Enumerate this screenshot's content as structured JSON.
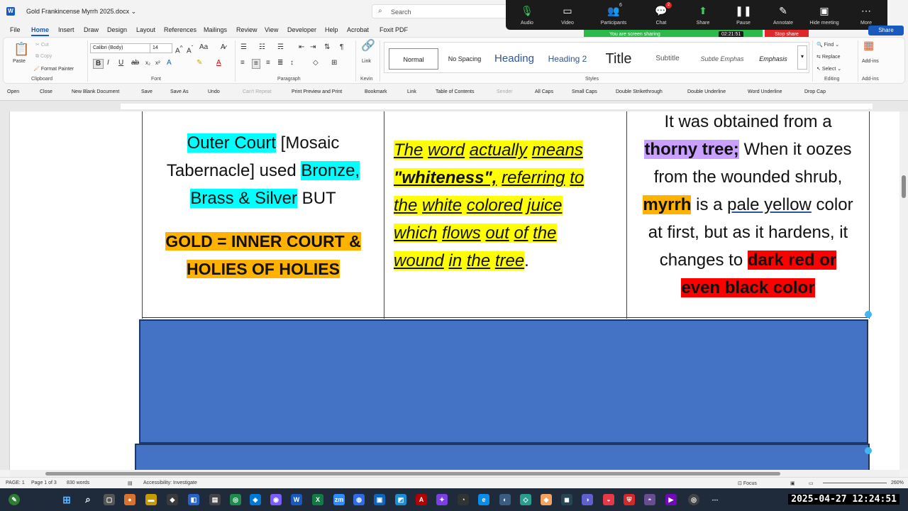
{
  "titlebar": {
    "app_icon": "W",
    "doc_title": "Gold Frankincense Myrrh 2025.docx ⌄",
    "search_placeholder": "Search"
  },
  "zoom": {
    "buttons": [
      {
        "label": "Audio",
        "icon": "mic-icon",
        "glyph": "🎙"
      },
      {
        "label": "Video",
        "icon": "camera-icon",
        "glyph": "▭"
      },
      {
        "label": "Participants",
        "icon": "participants-icon",
        "glyph": "👥",
        "count": "6"
      },
      {
        "label": "Chat",
        "icon": "chat-icon",
        "glyph": "💬",
        "badge": "2"
      },
      {
        "label": "Share",
        "icon": "share-screen-icon",
        "glyph": "⬆"
      },
      {
        "label": "Pause",
        "icon": "pause-icon",
        "glyph": "❚❚"
      },
      {
        "label": "Annotate",
        "icon": "pen-icon",
        "glyph": "✎"
      },
      {
        "label": "Hide meeting",
        "icon": "hide-meeting-icon",
        "glyph": "▣"
      },
      {
        "label": "More",
        "icon": "more-icon",
        "glyph": "⋯"
      }
    ],
    "sharing_text": "You are screen sharing",
    "timer": "02:21:51",
    "stop_share": "Stop share"
  },
  "ribbon_tabs": [
    "File",
    "Home",
    "Insert",
    "Draw",
    "Design",
    "Layout",
    "References",
    "Mailings",
    "Review",
    "View",
    "Developer",
    "Help",
    "Acrobat",
    "Foxit PDF"
  ],
  "share_button": "Share",
  "ribbon": {
    "clipboard": {
      "paste": "Paste",
      "cut": "Cut",
      "copy": "Copy",
      "format_painter": "Format Painter",
      "label": "Clipboard"
    },
    "font": {
      "name": "Calibri (Body)",
      "size": "14",
      "label": "Font"
    },
    "paragraph": {
      "label": "Paragraph"
    },
    "kevin": {
      "link": "Link",
      "label": "Kevin"
    },
    "styles": {
      "label": "Styles",
      "items": [
        "Normal",
        "No Spacing",
        "Heading",
        "Heading 2",
        "Title",
        "Subtitle",
        "Subtle Emphas",
        "Emphasis"
      ]
    },
    "editing": {
      "find": "Find",
      "replace": "Replace",
      "select": "Select",
      "label": "Editing"
    },
    "addins": {
      "label": "Add-ins",
      "name": "Add-ins"
    }
  },
  "qat": [
    "Open",
    "Close",
    "New Blank Document",
    "Save",
    "Save As",
    "Undo",
    "Can't Repeat",
    "Print Preview and Print",
    "Bookmark",
    "Link",
    "Table of Contents",
    "Sender",
    "All Caps",
    "Small Caps",
    "Double Strikethrough",
    "Double Underline",
    "Word Underline",
    "Drop Cap"
  ],
  "document": {
    "col1": {
      "a1": "Outer Court",
      "a2": " [Mosaic Tabernacle] used ",
      "a3": "Bronze,",
      "a4": "Brass & Silver",
      "a5": " BUT",
      "b1": "GOLD = INNER COURT &",
      "b2": "HOLIES OF HOLIES"
    },
    "col2": {
      "w1": "The",
      "w2": "word",
      "w3": "actually",
      "w4": "means",
      "w5": "\"whiteness\",",
      "w6": "referring",
      "w7": "to",
      "w8": "the",
      "w9": "white",
      "w10": "colored",
      "w11": "juice",
      "w12": "which",
      "w13": "flows",
      "w14": "out",
      "w15": "of",
      "w16": "the",
      "w17": "wound",
      "w18": "in",
      "w19": "the",
      "w20": "tree",
      "w21": "."
    },
    "col3": {
      "l1": "It was obtained from a",
      "l2a": "thorny tree;",
      "l2b": " When it oozes",
      "l3": "from the wounded shrub,",
      "l4a": "myrrh",
      "l4b": " is a ",
      "l4c": "pale yellow",
      "l4d": " color",
      "l5": "at first, but as it hardens, it",
      "l6a": "changes to ",
      "l6b": "dark red or",
      "l7": "even black color"
    }
  },
  "status": {
    "page": "PAGE: 1",
    "pages": "Page 1 of 3",
    "words": "830 words",
    "accessibility": "Accessibility: Investigate",
    "focus": "Focus",
    "zoom": "260%"
  },
  "clock": "2025-04-27  12:24:51"
}
